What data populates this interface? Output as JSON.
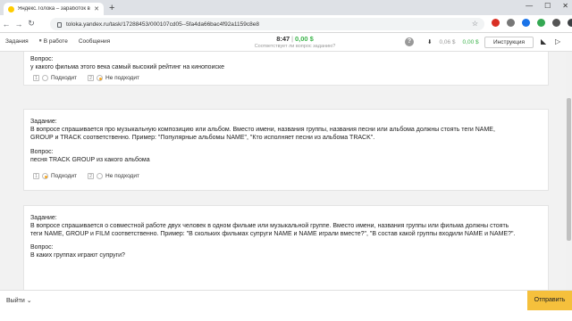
{
  "browser": {
    "tab_title": "Яндекс.Толока – заработок в и...",
    "url": "toloka.yandex.ru/task/17288453/000107cd05--5fa4da66bac4f92a1159c8e8"
  },
  "app": {
    "nav": [
      "Задания",
      "В работе",
      "Сообщения"
    ],
    "timer": "8:47",
    "earned": "0,00 $",
    "timer_sub": "Соответствует ли вопрос заданию?",
    "help": "?",
    "balance_main": "0,06 $",
    "balance_bonus": "0,00 $",
    "instructions": "Инструкция"
  },
  "tasks": [
    {
      "question_label": "Вопрос:",
      "question": "у какого фильма этого века самый высокий рейтинг на кинопоиске",
      "options": [
        {
          "key": "1",
          "label": "Подходит",
          "selected": false
        },
        {
          "key": "2",
          "label": "Не подходит",
          "selected": true
        }
      ]
    },
    {
      "task_label": "Задание:",
      "task_lines": [
        "В вопросе спрашивается про музыкальную композицию или альбом. Вместо имени, названия группы, названия песни или альбома должны стоять теги NAME,",
        "GROUP и TRACK соответственно. Пример: \"Популярные альбомы NAME\", \"Кто исполняет песни из альбома TRACK\"."
      ],
      "question_label": "Вопрос:",
      "question": "песня TRACK GROUP из какого альбома",
      "options": [
        {
          "key": "1",
          "label": "Подходит",
          "selected": true
        },
        {
          "key": "2",
          "label": "Не подходит",
          "selected": false
        }
      ]
    },
    {
      "task_label": "Задание:",
      "task_lines": [
        "В вопросе спрашивается о совместной работе двух человек в одном фильме или музыкальной группе. Вместо имени, названия группы или фильма должны стоять",
        "теги NAME, GROUP и FILM соответственно. Пример: \"В скольких фильмах супруги NAME и NAME играли вместе?\", \"В состав какой группы входили NAME и NAME?\"."
      ],
      "question_label": "Вопрос:",
      "question": "В каких группах играют супруги?"
    }
  ],
  "footer": {
    "exit": "Выйти",
    "submit": "Отправить"
  },
  "colors": {
    "accent": "#f5c03c",
    "money": "#3bb34a",
    "radio": "#f5a623"
  }
}
